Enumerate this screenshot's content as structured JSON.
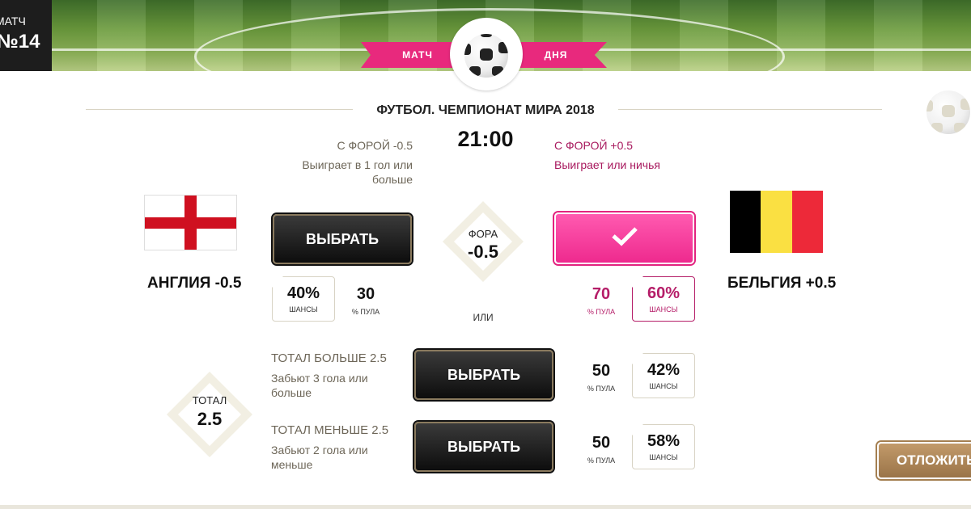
{
  "header": {
    "match_label": "МАТЧ",
    "match_number": "№14",
    "ribbon_left": "МАТЧ",
    "ribbon_right": "ДНЯ"
  },
  "event": {
    "title": "ФУТБОЛ. ЧЕМПИОНАТ МИРА 2018",
    "time": "21:00"
  },
  "home": {
    "team": "АНГЛИЯ -0.5",
    "handicap_label": "С ФОРОЙ -0.5",
    "handicap_desc": "Выиграет в 1 гол или больше",
    "button": "ВЫБРАТЬ",
    "chance_value": "40%",
    "chance_label": "ШАНСЫ",
    "pool_value": "30",
    "pool_label": "% ПУЛА",
    "flag_colors": {
      "base": "#ffffff",
      "cross": "#cf1020"
    }
  },
  "away": {
    "team": "БЕЛЬГИЯ +0.5",
    "handicap_label": "С ФОРОЙ +0.5",
    "handicap_desc": "Выиграет или ничья",
    "selected_icon": "checkmark-icon",
    "pool_value": "70",
    "pool_label": "% ПУЛА",
    "chance_value": "60%",
    "chance_label": "ШАНСЫ",
    "flag_colors": [
      "#000000",
      "#fae042",
      "#ed2939"
    ]
  },
  "handicap": {
    "label": "ФОРА",
    "value": "-0.5",
    "or_label": "ИЛИ"
  },
  "total": {
    "label": "ТОТАЛ",
    "value": "2.5",
    "over": {
      "label": "ТОТАЛ БОЛЬШЕ 2.5",
      "desc": "Забьют 3 гола или больше",
      "button": "ВЫБРАТЬ",
      "pool_value": "50",
      "pool_label": "% ПУЛА",
      "chance_value": "42%",
      "chance_label": "ШАНСЫ"
    },
    "under": {
      "label": "ТОТАЛ МЕНЬШЕ 2.5",
      "desc": "Забьют 2 гола или меньше",
      "button": "ВЫБРАТЬ",
      "pool_value": "50",
      "pool_label": "% ПУЛА",
      "chance_value": "58%",
      "chance_label": "ШАНСЫ"
    }
  },
  "actions": {
    "postpone": "ОТЛОЖИТЬ"
  },
  "colors": {
    "accent_pink": "#e8297d",
    "pink_text": "#a8195e",
    "gold": "#9a7448",
    "beige": "#f2efe3"
  }
}
